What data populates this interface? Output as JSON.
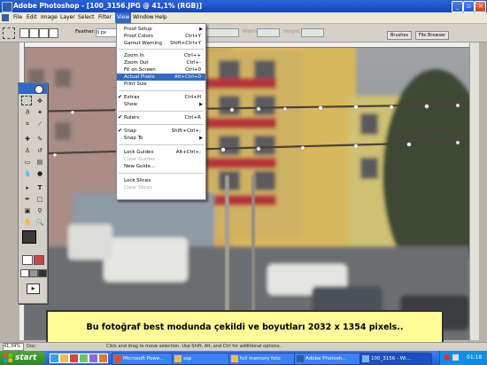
{
  "window": {
    "title": "Adobe Photoshop - [100_3156.JPG @ 41,1% (RGB)]",
    "buttons": {
      "minimize": "_",
      "restore": "▫",
      "close": "×"
    }
  },
  "menubar": {
    "items": [
      "File",
      "Edit",
      "Image",
      "Layer",
      "Select",
      "Filter",
      "View",
      "Window",
      "Help"
    ],
    "active": "View"
  },
  "options_bar": {
    "feather_label": "Feather:",
    "feather_value": "0 px",
    "width_label": "Width:",
    "height_label": "Height:",
    "palette_tabs": [
      "Brushes",
      "File Browser"
    ]
  },
  "view_menu": {
    "groups": [
      [
        {
          "label": "Proof Setup",
          "shortcut": "",
          "submenu": true
        },
        {
          "label": "Proof Colors",
          "shortcut": "Ctrl+Y"
        },
        {
          "label": "Gamut Warning",
          "shortcut": "Shift+Ctrl+Y"
        }
      ],
      [
        {
          "label": "Zoom In",
          "shortcut": "Ctrl++"
        },
        {
          "label": "Zoom Out",
          "shortcut": "Ctrl+-"
        },
        {
          "label": "Fit on Screen",
          "shortcut": "Ctrl+0"
        },
        {
          "label": "Actual Pixels",
          "shortcut": "Alt+Ctrl+0",
          "highlighted": true
        },
        {
          "label": "Print Size",
          "shortcut": ""
        }
      ],
      [
        {
          "label": "Extras",
          "shortcut": "Ctrl+H",
          "checked": true
        },
        {
          "label": "Show",
          "shortcut": "",
          "submenu": true
        }
      ],
      [
        {
          "label": "Rulers",
          "shortcut": "Ctrl+R",
          "checked": true
        }
      ],
      [
        {
          "label": "Snap",
          "shortcut": "Shift+Ctrl+;",
          "checked": true
        },
        {
          "label": "Snap To",
          "shortcut": "",
          "submenu": true
        }
      ],
      [
        {
          "label": "Lock Guides",
          "shortcut": "Alt+Ctrl+;"
        },
        {
          "label": "Clear Guides",
          "shortcut": "",
          "disabled": true
        },
        {
          "label": "New Guide...",
          "shortcut": ""
        }
      ],
      [
        {
          "label": "Lock Slices",
          "shortcut": ""
        },
        {
          "label": "Clear Slices",
          "shortcut": "",
          "disabled": true
        }
      ]
    ]
  },
  "caption": {
    "text": "Bu fotoğraf best modunda çekildi ve boyutları  2032 x 1354 pixels.."
  },
  "status_bar": {
    "zoom": "41,34%",
    "doc_label": "Doc: ",
    "hint": "Click and drag to move selection. Use Shift, Alt, and Ctrl for additional options."
  },
  "taskbar": {
    "start_label": "start",
    "tasks": [
      {
        "label": "Microsoft Powe...",
        "active": false
      },
      {
        "label": "ssp",
        "active": false
      },
      {
        "label": "full memory foto",
        "active": false
      },
      {
        "label": "Adobe Photosh...",
        "active": false
      },
      {
        "label": "100_3156 - Wi...",
        "active": true
      }
    ],
    "clock": "01:18"
  },
  "colors": {
    "title_bar": "#1546bd",
    "menu_highlight": "#316ac5",
    "caption_bg": "#fffb96",
    "taskbar": "#245edb",
    "start": "#2d8a1f"
  }
}
